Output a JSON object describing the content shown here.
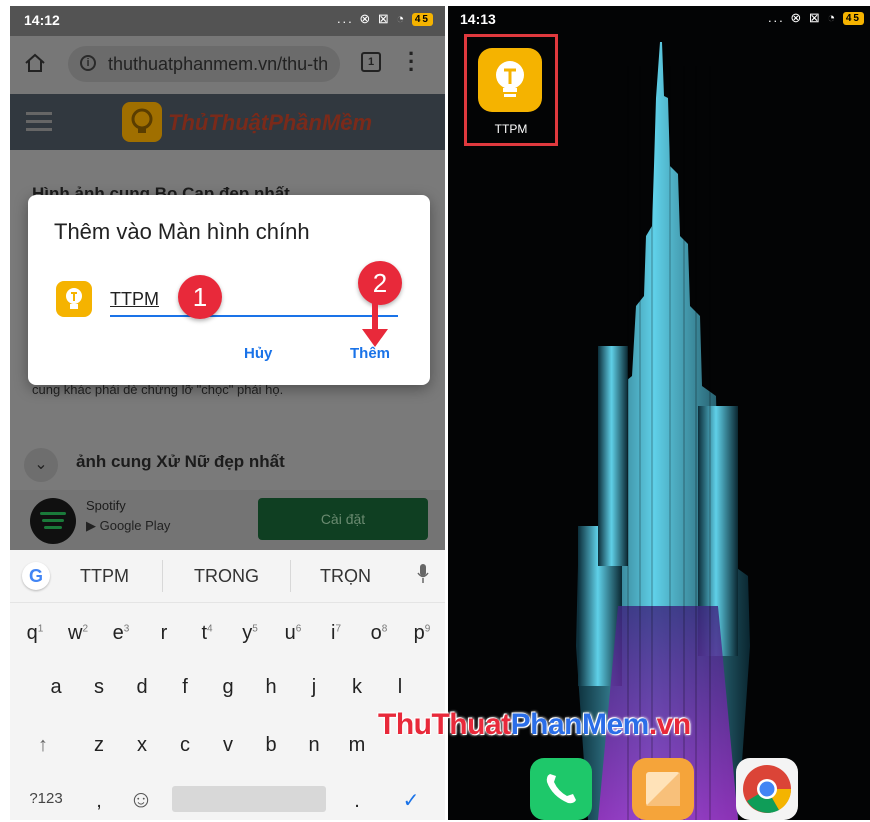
{
  "left_phone": {
    "status": {
      "time": "14:12",
      "icons": "... ⊗ ⊠ ◔",
      "battery": "45"
    },
    "browser": {
      "url": "thuthuatphanmem.vn/thu-th",
      "tab_count": "1"
    },
    "site": {
      "logo_text": "ThủThuậtPhầnMềm"
    },
    "article": {
      "title_1": "Hình ảnh cung Bọ Cạp đẹp nhất",
      "snippet": "cung khác phải dè chừng lỡ \"chọc\" phải họ.",
      "title_2": "ảnh cung Xử Nữ đẹp nhất"
    },
    "ad": {
      "app_name": "Spotify",
      "store": "Google Play",
      "install_label": "Cài đặt"
    },
    "dialog": {
      "title": "Thêm vào Màn hình chính",
      "input_value": "TTPM",
      "cancel_label": "Hủy",
      "add_label": "Thêm",
      "step_1": "1",
      "step_2": "2"
    },
    "keyboard": {
      "suggestions": [
        "TTPM",
        "TRONG",
        "TRỌN"
      ],
      "row1": [
        {
          "k": "q",
          "n": "1"
        },
        {
          "k": "w",
          "n": "2"
        },
        {
          "k": "e",
          "n": "3"
        },
        {
          "k": "r",
          "n": ""
        },
        {
          "k": "t",
          "n": "4"
        },
        {
          "k": "y",
          "n": "5"
        },
        {
          "k": "u",
          "n": "6"
        },
        {
          "k": "i",
          "n": "7"
        },
        {
          "k": "o",
          "n": "8"
        },
        {
          "k": "p",
          "n": "9"
        }
      ],
      "row2": [
        "a",
        "s",
        "d",
        "f",
        "g",
        "h",
        "j",
        "k",
        "l"
      ],
      "row3": [
        "z",
        "x",
        "c",
        "v",
        "b",
        "n",
        "m"
      ],
      "symbols_label": "?123",
      "comma": ",",
      "period": ".",
      "emoji": "☺",
      "enter": "✓",
      "shift": "↑"
    }
  },
  "right_phone": {
    "status": {
      "time": "14:13",
      "icons": "... ⊗ ⊠ ◔",
      "battery": "45"
    },
    "app": {
      "label": "TTPM"
    },
    "dock": [
      "phone-icon",
      "gallery-icon",
      "chrome-icon"
    ],
    "watermark": {
      "part1": "ThuThuat",
      "part2": "PhanMem",
      "part3": ".vn"
    }
  },
  "colors": {
    "accent_blue": "#1a73e8",
    "badge_red": "#e8293a",
    "app_yellow": "#f5b300"
  }
}
